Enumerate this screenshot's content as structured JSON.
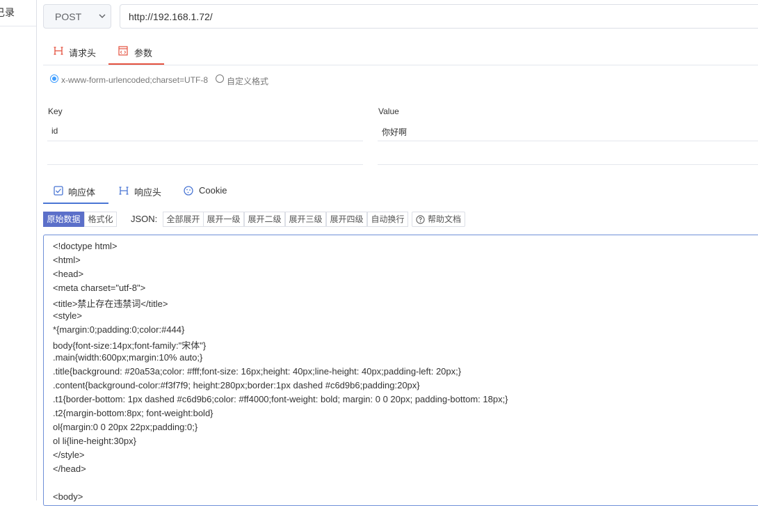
{
  "sidebar": {
    "title": "己录"
  },
  "request": {
    "method": "POST",
    "url": "http://192.168.1.72/"
  },
  "request_tabs": [
    {
      "label": "请求头",
      "icon": "heading-icon",
      "active": false
    },
    {
      "label": "参数",
      "icon": "code-icon",
      "active": true
    }
  ],
  "body_format": {
    "options": [
      {
        "label": "x-www-form-urlencoded;charset=UTF-8",
        "checked": true
      },
      {
        "label": "自定义格式",
        "checked": false
      }
    ]
  },
  "params": {
    "key_header": "Key",
    "value_header": "Value",
    "rows": [
      {
        "key": "id",
        "value": "你好啊"
      },
      {
        "key": "",
        "value": ""
      }
    ]
  },
  "response_tabs": [
    {
      "label": "响应体",
      "icon": "checkbox-icon",
      "active": true
    },
    {
      "label": "响应头",
      "icon": "heading-icon",
      "active": false
    },
    {
      "label": "Cookie",
      "icon": "cookie-icon",
      "active": false
    }
  ],
  "toolbar": {
    "raw": "原始数据",
    "format": "格式化",
    "json_label": "JSON:",
    "json_buttons": [
      "全部展开",
      "展开一级",
      "展开二级",
      "展开三级",
      "展开四级",
      "自动换行"
    ],
    "help": "帮助文档"
  },
  "response_body": [
    "<!doctype html>",
    "<html>",
    "<head>",
    "<meta charset=\"utf-8\">",
    "<title>禁止存在违禁词</title>",
    "<style>",
    "*{margin:0;padding:0;color:#444}",
    "body{font-size:14px;font-family:\"宋体\"}",
    ".main{width:600px;margin:10% auto;}",
    ".title{background: #20a53a;color: #fff;font-size: 16px;height: 40px;line-height: 40px;padding-left: 20px;}",
    ".content{background-color:#f3f7f9; height:280px;border:1px dashed #c6d9b6;padding:20px}",
    ".t1{border-bottom: 1px dashed #c6d9b6;color: #ff4000;font-weight: bold; margin: 0 0 20px; padding-bottom: 18px;}",
    ".t2{margin-bottom:8px; font-weight:bold}",
    "ol{margin:0 0 20px 22px;padding:0;}",
    "ol li{line-height:30px}",
    "</style>",
    "</head>",
    "",
    "<body>"
  ],
  "colors": {
    "accent_red": "#e4503e",
    "accent_blue": "#4a76d4",
    "primary_button": "#5b6fc9",
    "radio_checked": "#409eff"
  }
}
